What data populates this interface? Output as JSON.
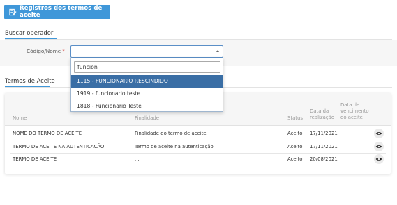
{
  "header": {
    "title": "Registros dos termos de aceite",
    "icon": "edit-document-icon"
  },
  "search_section": {
    "title": "Buscar operador",
    "field_label": "Código/Nome",
    "required_marker": "*",
    "dropdown": {
      "search_value": "funcion",
      "options": [
        {
          "label": "1115 - FUNCIONARIO RESCINDIDO",
          "active": true
        },
        {
          "label": "1919 - funcionario teste",
          "active": false
        },
        {
          "label": "1818 - Funcionario Teste",
          "active": false
        }
      ]
    }
  },
  "terms_section": {
    "title": "Termos de Aceite",
    "columns": {
      "name": "Nome",
      "purpose": "Finalidade",
      "status": "Status",
      "date_done": [
        "Data da",
        "realização"
      ],
      "due_date": [
        "Data de",
        "vencimento",
        "do aceite"
      ]
    },
    "rows": [
      {
        "name": "NOME DO TERMO DE ACEITE",
        "purpose": "Finalidade do termo de aceite",
        "status": "Aceito",
        "date": "17/11/2021"
      },
      {
        "name": "TERMO DE ACEITE NA AUTENTICAÇÃO",
        "purpose": "Termo de aceite na autenticação",
        "status": "Aceito",
        "date": "17/11/2021"
      },
      {
        "name": "TERMO DE ACEITE",
        "purpose": "...",
        "status": "Aceito",
        "date": "20/08/2021"
      }
    ]
  },
  "colors": {
    "accent": "#3f97d9",
    "selected_option": "#3a6ea5",
    "required": "#d9534f"
  }
}
